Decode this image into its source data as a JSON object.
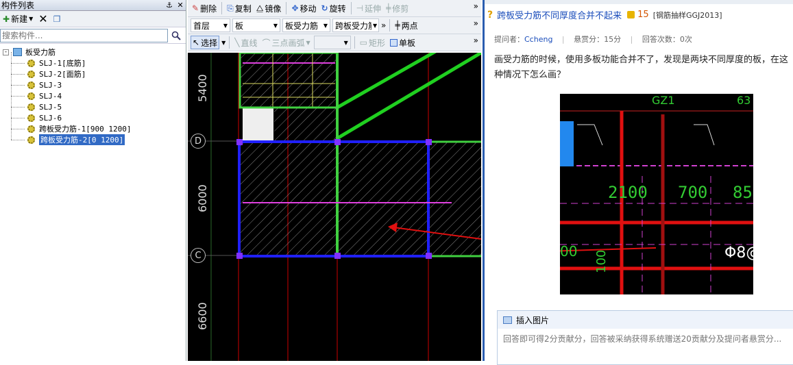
{
  "left_panel": {
    "title": "构件列表",
    "new_label": "新建",
    "search_placeholder": "搜索构件...",
    "tree": {
      "root": "板受力筋",
      "items": [
        "SLJ-1[底筋]",
        "SLJ-2[面筋]",
        "SLJ-3",
        "SLJ-4",
        "SLJ-5",
        "SLJ-6",
        "跨板受力筋-1[900 1200]",
        "跨板受力筋-2[0 1200]"
      ],
      "selected_index": 7
    }
  },
  "cad": {
    "toolbar1": {
      "delete": "删除",
      "copy": "复制",
      "mirror": "镜像",
      "move": "移动",
      "rotate": "旋转",
      "extend": "延伸",
      "trim": "修剪"
    },
    "toolbar2": {
      "floor": "首层",
      "component_type": "板",
      "rebar_type": "板受力筋",
      "component": "跨板受力筋-",
      "two_point": "两点"
    },
    "toolbar3": {
      "select": "选择",
      "line": "直线",
      "arc": "三点画弧",
      "rect": "矩形",
      "single_board": "单板"
    },
    "dims": {
      "top": "5400",
      "mid": "6000",
      "bottom": "6600"
    },
    "axes": {
      "d": "D",
      "c": "C"
    }
  },
  "qa": {
    "title": "跨板受力筋不同厚度合并不起来",
    "points": "15",
    "tag": "[钢筋抽样GGJ2013]",
    "asker_label": "提问者：",
    "asker": "Ccheng",
    "bounty": "悬赏分：15分",
    "answers": "回答次数：0次",
    "question": "画受力筋的时候，使用多板功能合并不了，发现是两块不同厚度的板，在这种情况下怎么画？",
    "shot_labels": {
      "a": "2100",
      "b": "700",
      "c": "85",
      "d": "GZ1",
      "e": "Φ8@",
      "f": "100",
      "g": "00",
      "h": "63"
    },
    "insert_image": "插入图片",
    "answer_placeholder": "回答即可得2分贡献分，回答被采纳获得系统赠送20贡献分及提问者悬赏分..."
  },
  "colors": {
    "accent": "#316ac5",
    "link": "#1a4dbb"
  }
}
